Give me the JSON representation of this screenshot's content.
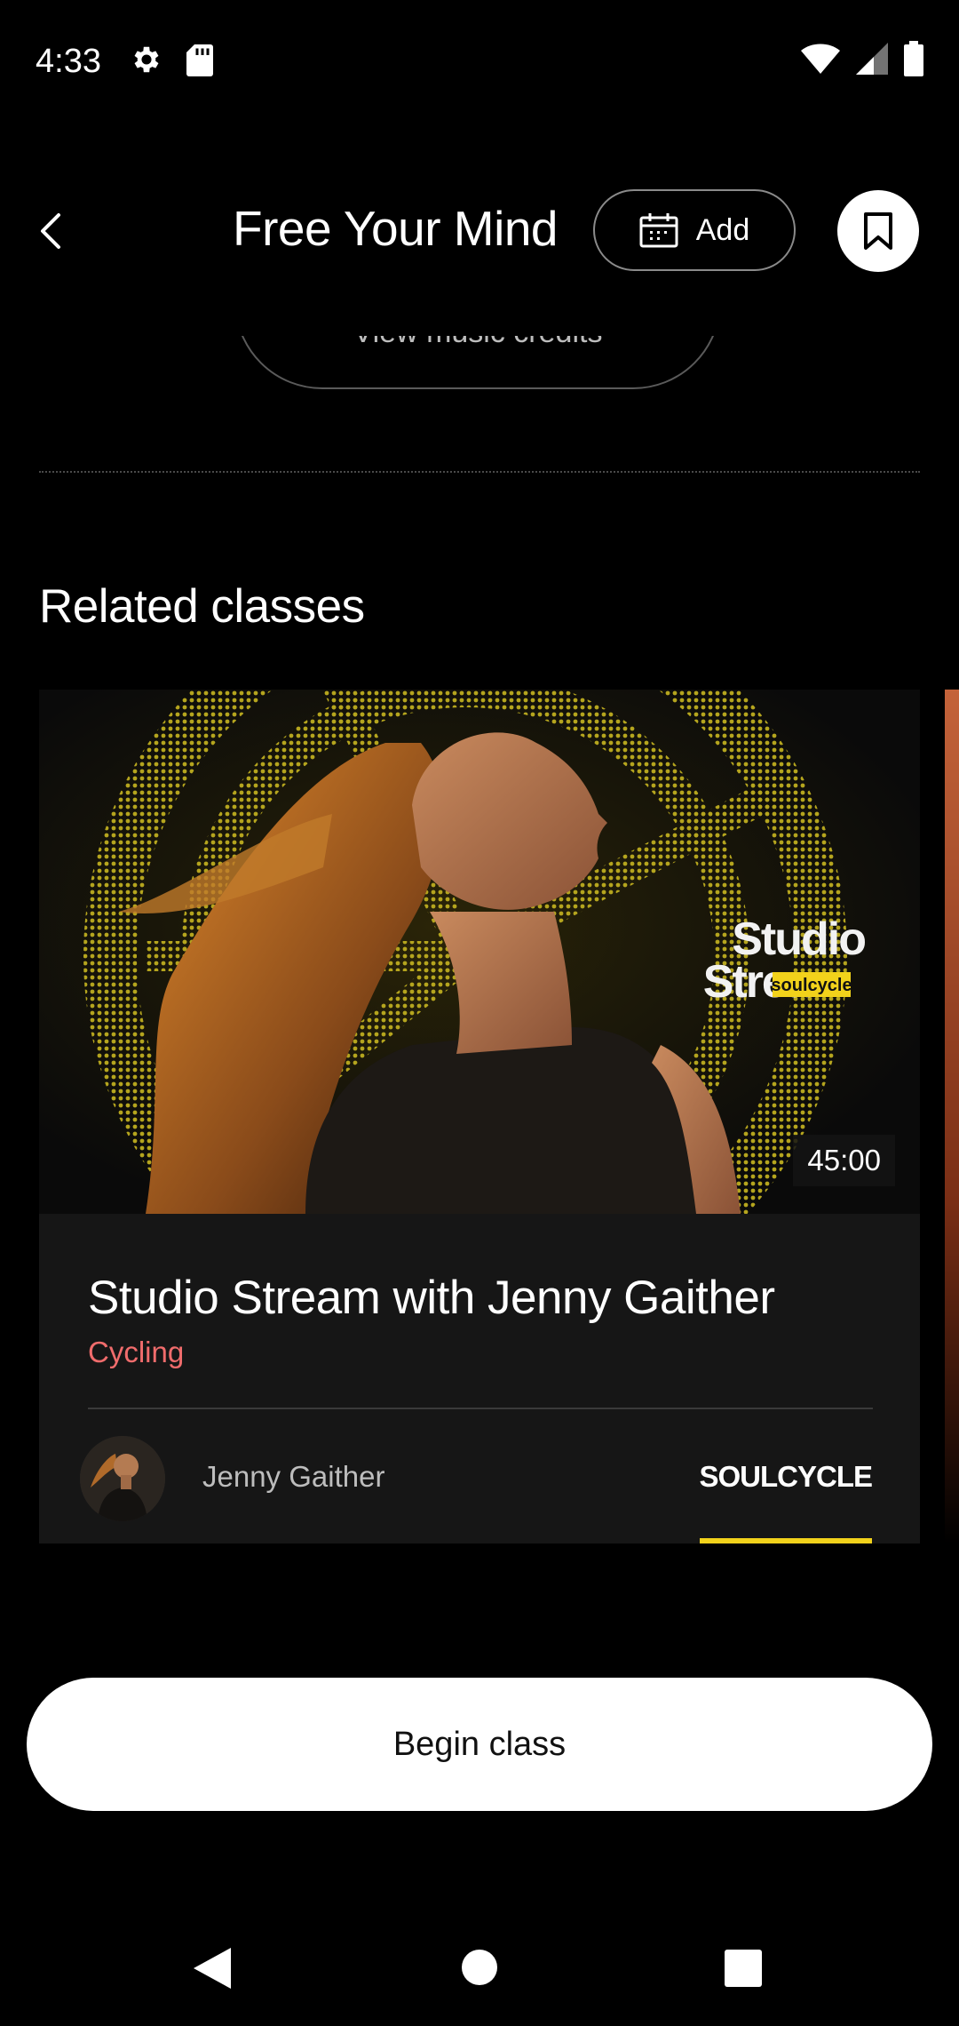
{
  "status_bar": {
    "time": "4:33"
  },
  "header": {
    "title": "Free Your Mind",
    "add_label": "Add"
  },
  "music_credits_label": "View music credits",
  "related": {
    "section_title": "Related classes",
    "cards": [
      {
        "duration": "45:00",
        "title": "Studio Stream with Jenny Gaither",
        "category": "Cycling",
        "instructor": "Jenny Gaither",
        "brand": "SOULCYCLE",
        "thumbnail_text": {
          "line1": "Studio",
          "line2": "Stream",
          "tag": "soulcycle"
        }
      }
    ]
  },
  "begin_class_label": "Begin class",
  "colors": {
    "category": "#f06c6c",
    "brand_underline": "#f2d21b",
    "background": "#000000"
  }
}
